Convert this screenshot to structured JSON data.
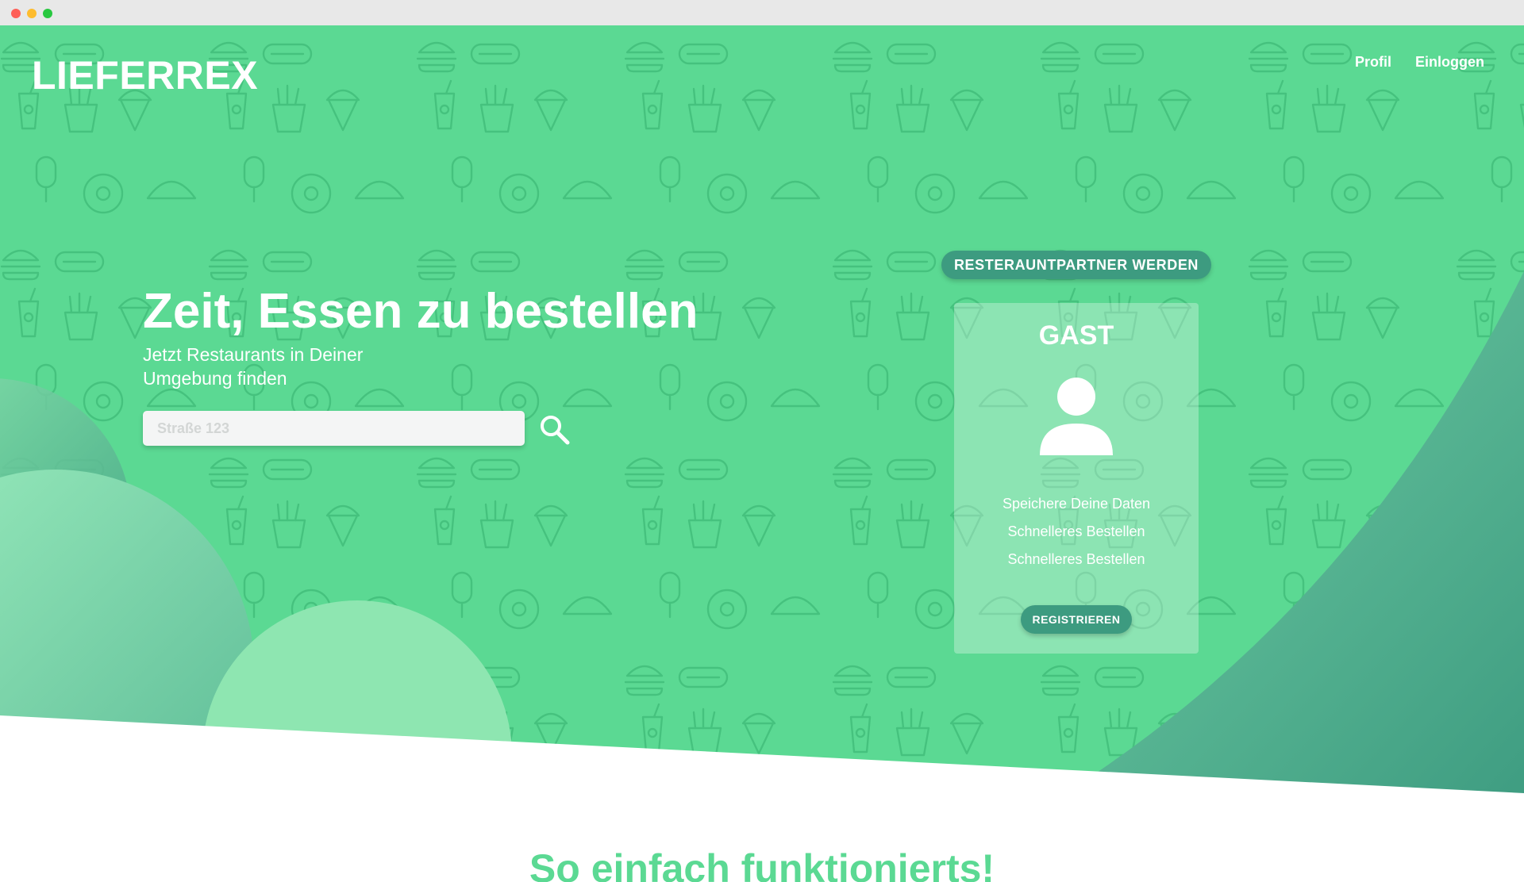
{
  "brand": {
    "name": "LIEFERREX"
  },
  "nav": {
    "profile": "Profil",
    "login": "Einloggen"
  },
  "hero": {
    "headline": "Zeit, Essen zu bestellen",
    "subline": "Jetzt Restaurants in Deiner Umgebung finden",
    "search_placeholder": "Straße 123"
  },
  "partner": {
    "label": "RESTERAUNTPARTNER WERDEN"
  },
  "guest": {
    "title": "GAST",
    "benefits": [
      "Speichere Deine Daten",
      "Schnelleres Bestellen",
      "Schnelleres Bestellen"
    ],
    "register_label": "REGISTRIEREN"
  },
  "section": {
    "title": "So einfach funktionierts!"
  },
  "colors": {
    "primary": "#5bd993",
    "dark": "#3d9b80",
    "white": "#ffffff"
  },
  "icons": [
    "search-icon",
    "user-icon",
    "burger-icon",
    "hotdog-icon",
    "drink-icon",
    "fries-icon",
    "icecream-icon",
    "donut-icon",
    "taco-icon",
    "popsicle-icon"
  ]
}
